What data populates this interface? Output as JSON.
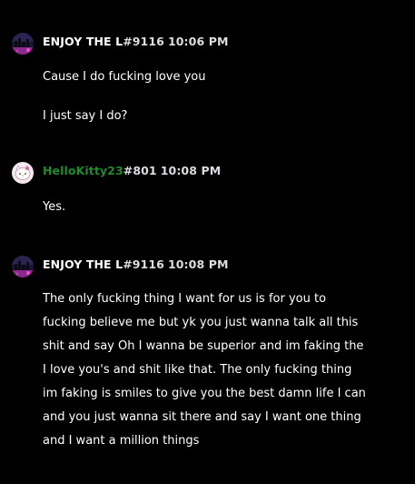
{
  "messages": [
    {
      "username": "ENJOY THE L",
      "discriminator": "#9116",
      "timestamp": "10:06 PM",
      "username_color": "#ffffff",
      "avatar_icon": "night-city-avatar",
      "lines": [
        "Cause I do fucking love you",
        "I just say I do?"
      ]
    },
    {
      "username": "HelloKitty23",
      "discriminator": "#801",
      "timestamp": "10:08 PM",
      "username_color": "#1f8b2c",
      "avatar_icon": "hello-kitty-avatar",
      "lines": [
        "Yes."
      ]
    },
    {
      "username": "ENJOY THE L",
      "discriminator": "#9116",
      "timestamp": "10:08 PM",
      "username_color": "#ffffff",
      "avatar_icon": "night-city-avatar",
      "lines": [
        "The only fucking thing I want for us is for you to",
        "fucking believe me but yk you just wanna talk all this",
        "shit and say Oh I wanna be superior and im faking the",
        "I love you's and shit like that. The only fucking thing",
        "im faking is smiles to give you the best damn life I can",
        "and you just wanna sit there and say I want one thing",
        "and I want a million things"
      ]
    }
  ]
}
